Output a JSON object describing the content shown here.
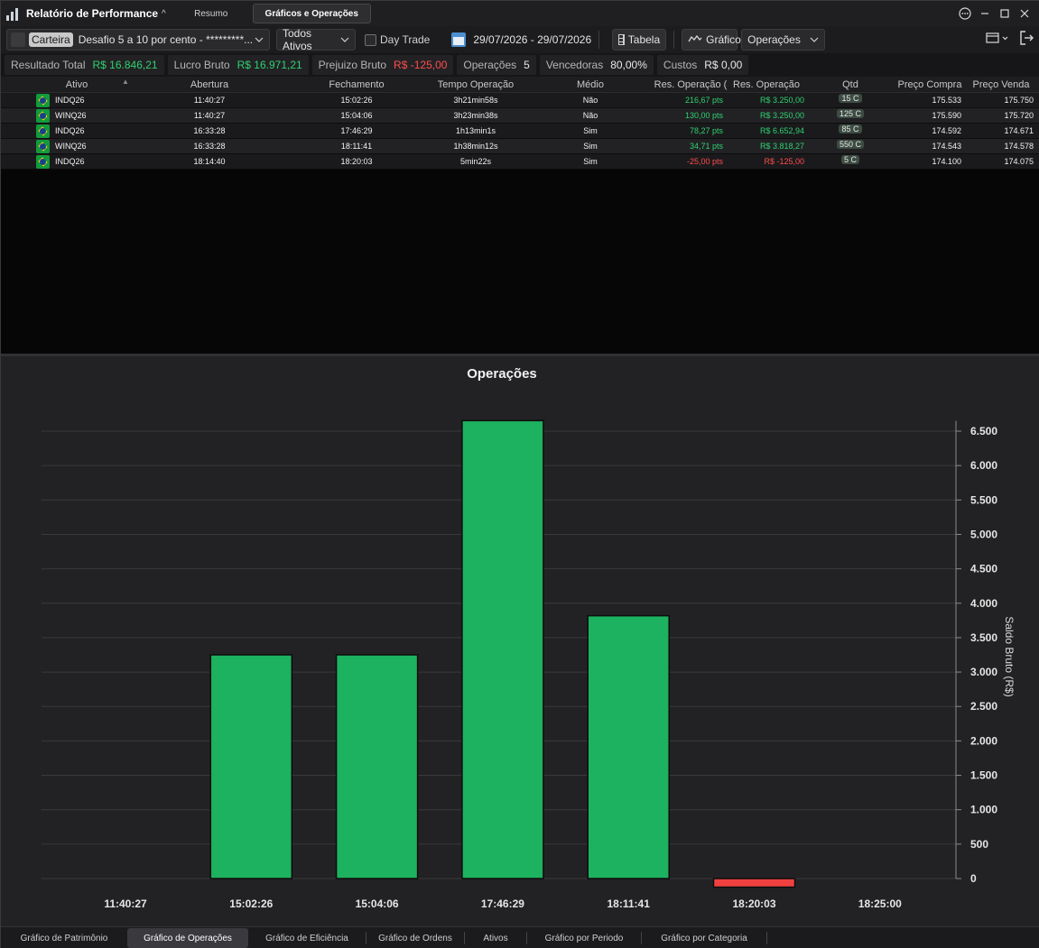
{
  "app": {
    "title": "Relatório de Performance",
    "title_chevron": "^",
    "tabs": [
      "Resumo",
      "Gráficos e Operações"
    ],
    "active_tab": 1,
    "window_buttons": [
      "more-icon",
      "minimize-icon",
      "maximize-icon",
      "close-icon"
    ]
  },
  "toolbar": {
    "carteira_tag": "Carteira",
    "carteira_value": "Desafio 5 a 10 por cento  - *********...",
    "assets_value": "Todos Ativos",
    "daytrade_label": "Day Trade",
    "daytrade_checked": false,
    "date_range": "29/07/2026 - 29/07/2026",
    "tabela_label": "Tabela",
    "grafico_label": "Gráfico",
    "chart_select_value": "Operações"
  },
  "summary": [
    {
      "label": "Resultado Total",
      "value": "R$ 16.846,21",
      "tone": "pos"
    },
    {
      "label": "Lucro Bruto",
      "value": "R$ 16.971,21",
      "tone": "pos"
    },
    {
      "label": "Prejuizo Bruto",
      "value": "R$ -125,00",
      "tone": "neg"
    },
    {
      "label": "Operações",
      "value": "5",
      "tone": "neutral"
    },
    {
      "label": "Vencedoras",
      "value": "80,00%",
      "tone": "neutral"
    },
    {
      "label": "Custos",
      "value": "R$ 0,00",
      "tone": "neutral"
    }
  ],
  "table": {
    "headers": [
      "Ativo",
      "Abertura",
      "Fechamento",
      "Tempo Operação",
      "Médio",
      "Res. Operação (",
      "Res. Operação",
      "Qtd",
      "Preço Compra",
      "Preço Venda"
    ],
    "rows": [
      {
        "ativo": "INDQ26",
        "abertura": "11:40:27",
        "fechamento": "15:02:26",
        "tempo": "3h21min58s",
        "medio": "Não",
        "res_pts": "216,67 pts",
        "res_brl": "R$ 3.250,00",
        "qtd": "15 C",
        "compra": "175.533",
        "venda": "175.750",
        "tone": "pos"
      },
      {
        "ativo": "WINQ26",
        "abertura": "11:40:27",
        "fechamento": "15:04:06",
        "tempo": "3h23min38s",
        "medio": "Não",
        "res_pts": "130,00 pts",
        "res_brl": "R$ 3.250,00",
        "qtd": "125 C",
        "compra": "175.590",
        "venda": "175.720",
        "tone": "pos"
      },
      {
        "ativo": "INDQ26",
        "abertura": "16:33:28",
        "fechamento": "17:46:29",
        "tempo": "1h13min1s",
        "medio": "Sim",
        "res_pts": "78,27 pts",
        "res_brl": "R$ 6.652,94",
        "qtd": "85 C",
        "compra": "174.592",
        "venda": "174.671",
        "tone": "pos"
      },
      {
        "ativo": "WINQ26",
        "abertura": "16:33:28",
        "fechamento": "18:11:41",
        "tempo": "1h38min12s",
        "medio": "Sim",
        "res_pts": "34,71 pts",
        "res_brl": "R$ 3.818,27",
        "qtd": "550 C",
        "compra": "174.543",
        "venda": "174.578",
        "tone": "pos"
      },
      {
        "ativo": "INDQ26",
        "abertura": "18:14:40",
        "fechamento": "18:20:03",
        "tempo": "5min22s",
        "medio": "Sim",
        "res_pts": "-25,00 pts",
        "res_brl": "R$ -125,00",
        "qtd": "5 C",
        "compra": "174.100",
        "venda": "174.075",
        "tone": "neg"
      }
    ]
  },
  "chart_data": {
    "type": "bar",
    "title": "Operações",
    "ylabel": "Saldo Bruto (R$)",
    "xlabel": "",
    "categories": [
      "11:40:27",
      "15:02:26",
      "15:04:06",
      "17:46:29",
      "18:11:41",
      "18:20:03",
      "18:25:00"
    ],
    "values": [
      null,
      3250.0,
      3250.0,
      6652.94,
      3818.27,
      -125.0,
      null
    ],
    "ylim": [
      -125,
      6650
    ],
    "yticks": [
      0,
      500,
      1000,
      1500,
      2000,
      2500,
      3000,
      3500,
      4000,
      4500,
      5000,
      5500,
      6000,
      6500
    ],
    "ytick_labels": [
      "0",
      "500",
      "1.000",
      "1.500",
      "2.000",
      "2.500",
      "3.000",
      "3.500",
      "4.000",
      "4.500",
      "5.000",
      "5.500",
      "6.000",
      "6.500"
    ],
    "y_axis_side": "right",
    "grid": true,
    "colors": {
      "positive": "#1db25f",
      "negative": "#ef4040"
    }
  },
  "bottom_tabs": [
    "Gráfico de Patrimônio",
    "Gráfico de Operações",
    "Gráfico de Eficiência",
    "Gráfico de Ordens",
    "Ativos",
    "Gráfico por Periodo",
    "Gráfico por Categoria"
  ],
  "active_bottom_tab": 1
}
